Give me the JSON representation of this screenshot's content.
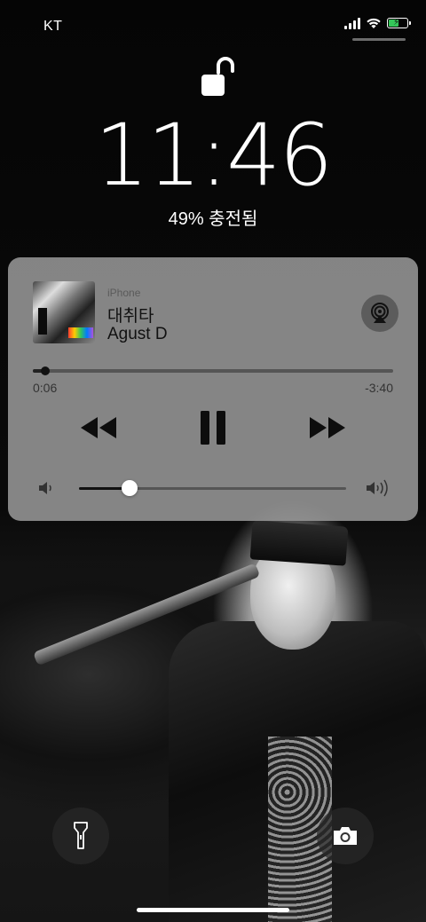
{
  "status_bar": {
    "carrier": "KT",
    "icons": [
      "cellular-signal-icon",
      "wifi-icon",
      "battery-charging-icon"
    ],
    "battery_level": 0.49
  },
  "lock_screen": {
    "lock_state": "unlocked",
    "time": "11:46",
    "charging_text": "49% 충전됨"
  },
  "now_playing": {
    "source": "iPhone",
    "title": "대취타",
    "artist": "Agust D",
    "elapsed": "0:06",
    "remaining": "-3:40",
    "progress": 0.03,
    "volume": 0.19,
    "controls": [
      "rewind-icon",
      "pause-icon",
      "fast-forward-icon"
    ],
    "airplay_icon": "airplay-icon"
  },
  "quick_actions": {
    "left": "flashlight-icon",
    "right": "camera-icon"
  },
  "colors": {
    "card_bg": "#969696",
    "battery_fill": "#35c759",
    "text_dark": "#111111"
  }
}
